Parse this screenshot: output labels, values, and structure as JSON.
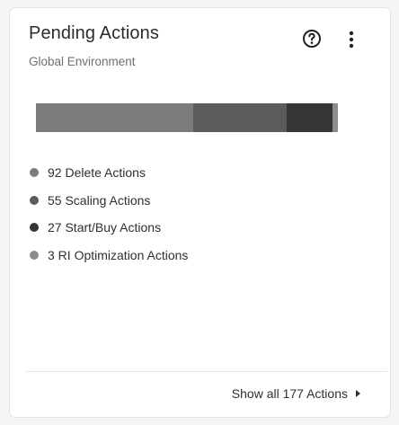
{
  "card": {
    "title": "Pending Actions",
    "subtitle": "Global Environment",
    "help_icon": "help-circle-icon",
    "menu_icon": "more-vertical-icon"
  },
  "breakdown": {
    "items": [
      {
        "label": "92 Delete Actions",
        "value": 92,
        "color": "#7c7c7c"
      },
      {
        "label": "55 Scaling Actions",
        "value": 55,
        "color": "#5b5b5b"
      },
      {
        "label": "27 Start/Buy Actions",
        "value": 27,
        "color": "#353535"
      },
      {
        "label": "3 RI Optimization Actions",
        "value": 3,
        "color": "#8c8c8c"
      }
    ]
  },
  "footer": {
    "link_label": "Show all 177 Actions",
    "link_icon": "caret-right-icon"
  }
}
